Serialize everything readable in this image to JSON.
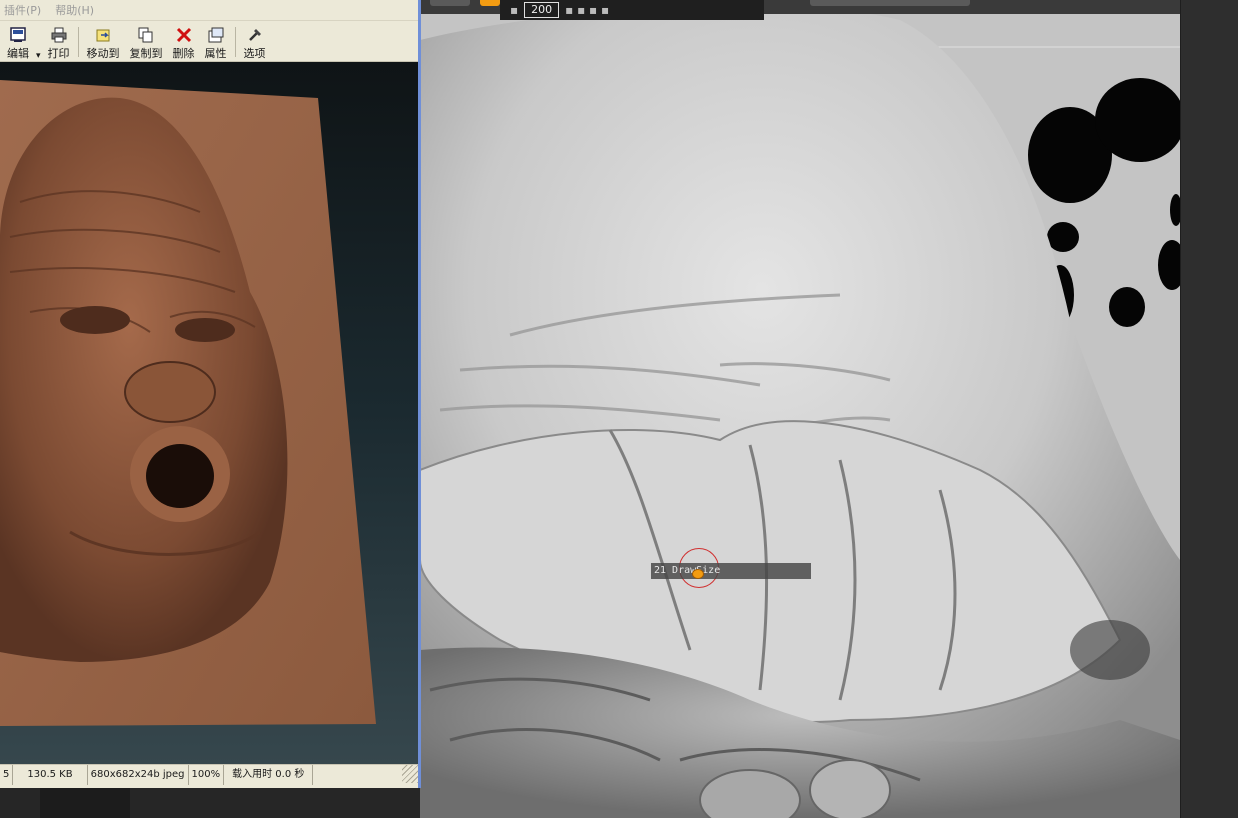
{
  "viewer": {
    "menu": [
      "插件(P)",
      "帮助(H)"
    ],
    "toolbar": [
      {
        "label": "编辑",
        "icon": "edit-icon"
      },
      {
        "label": "打印",
        "icon": "print-icon"
      },
      {
        "label": "移动到",
        "icon": "move-to-icon"
      },
      {
        "label": "复制到",
        "icon": "copy-to-icon"
      },
      {
        "label": "删除",
        "icon": "delete-icon"
      },
      {
        "label": "属性",
        "icon": "properties-icon"
      },
      {
        "label": "选项",
        "icon": "options-icon"
      }
    ],
    "status": {
      "index": "5",
      "size": "130.5 KB",
      "dims": "680x682x24b jpeg",
      "zoom": "100%",
      "load_time": "载入用时 0.0 秒"
    }
  },
  "zbrush": {
    "tooltip_key": "200",
    "brush_label": "21 DrawSize"
  },
  "colors": {
    "window_frame": "#6f8fd8",
    "clay": "#8a5a40",
    "cursor_ring": "#d03030",
    "cursor_dot": "#f39c12"
  }
}
